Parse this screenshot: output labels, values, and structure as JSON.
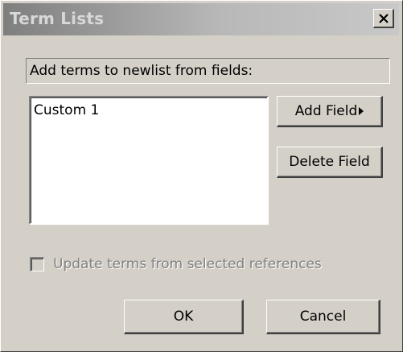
{
  "window": {
    "title": "Term Lists",
    "close_icon": "close-x-icon"
  },
  "header_label": "Add terms to newlist from fields:",
  "fields_list": {
    "items": [
      "Custom 1"
    ]
  },
  "buttons": {
    "add_field": "Add Field",
    "add_field_icon": "triangle-right-icon",
    "delete_field": "Delete Field",
    "ok": "OK",
    "cancel": "Cancel"
  },
  "update_option": {
    "label": "Update terms from selected references",
    "checked": false,
    "disabled": true
  }
}
